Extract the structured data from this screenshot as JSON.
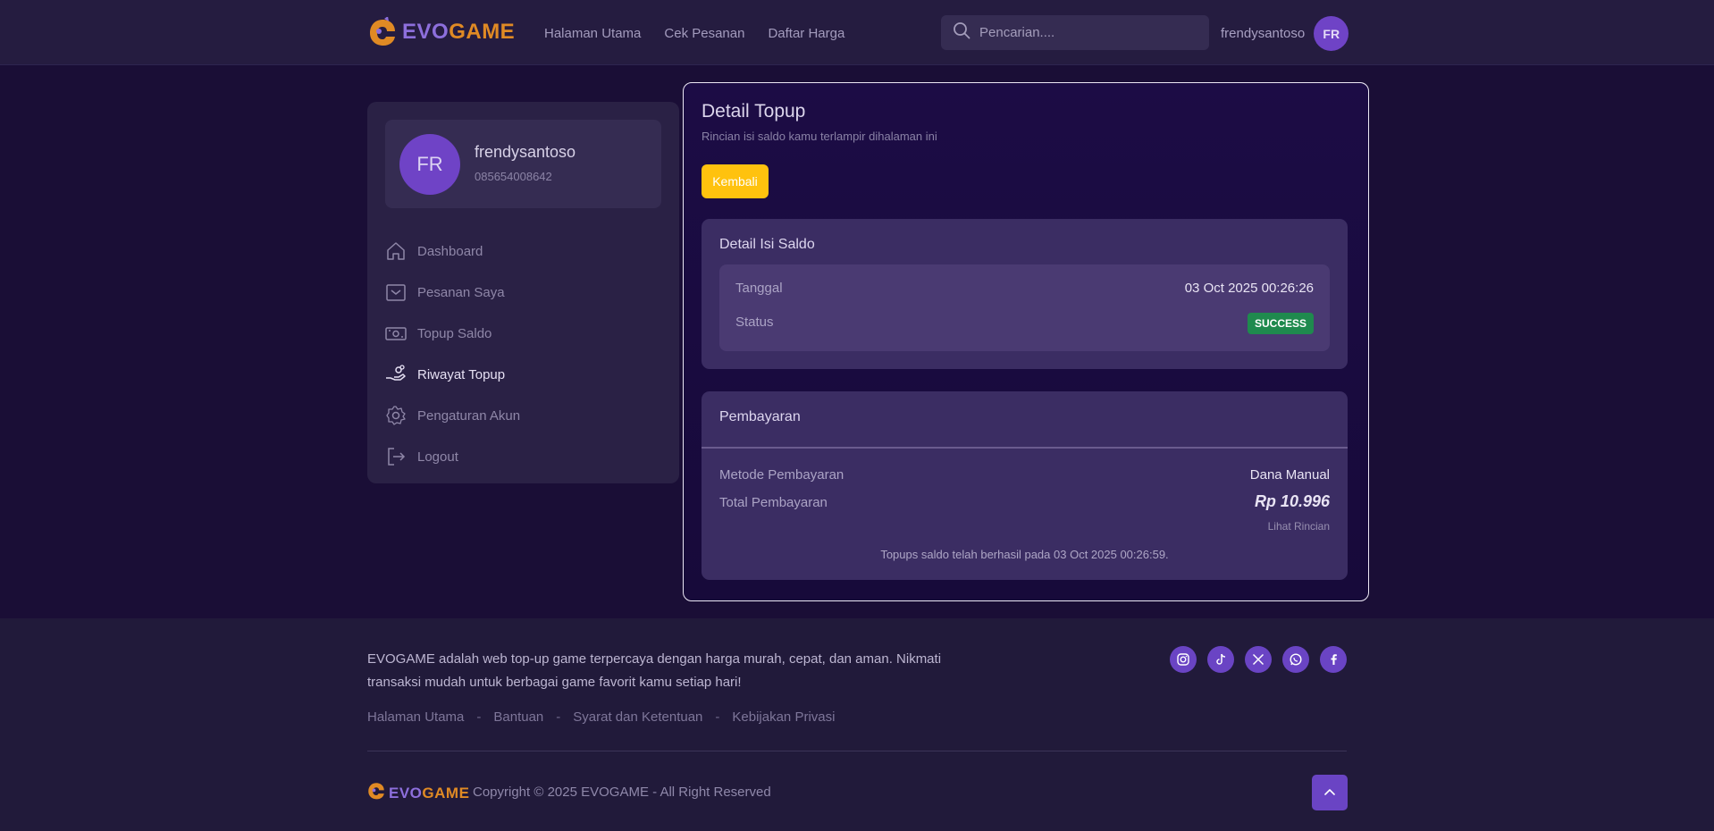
{
  "brand": {
    "evo": "EVO",
    "game": "GAME"
  },
  "nav": {
    "items": [
      "Halaman Utama",
      "Cek Pesanan",
      "Daftar Harga"
    ]
  },
  "search": {
    "placeholder": "Pencarian...."
  },
  "user": {
    "username": "frendysantoso",
    "initials": "FR",
    "phone": "085654008642"
  },
  "sidebar": {
    "items": [
      {
        "label": "Dashboard",
        "icon": "home-icon"
      },
      {
        "label": "Pesanan Saya",
        "icon": "inbox-icon"
      },
      {
        "label": "Topup Saldo",
        "icon": "cash-icon"
      },
      {
        "label": "Riwayat Topup",
        "icon": "hand-coins-icon",
        "active": true
      },
      {
        "label": "Pengaturan Akun",
        "icon": "gear-icon"
      },
      {
        "label": "Logout",
        "icon": "logout-icon"
      }
    ]
  },
  "main": {
    "title": "Detail Topup",
    "subtitle": "Rincian isi saldo kamu terlampir dihalaman ini",
    "back_label": "Kembali",
    "detail": {
      "title": "Detail Isi Saldo",
      "date_label": "Tanggal",
      "date_value": "03 Oct 2025 00:26:26",
      "status_label": "Status",
      "status_value": "SUCCESS",
      "status_color": "#1f8a4e"
    },
    "payment": {
      "title": "Pembayaran",
      "method_label": "Metode Pembayaran",
      "method_value": "Dana Manual",
      "total_label": "Total Pembayaran",
      "total_value": "Rp 10.996",
      "details_link": "Lihat Rincian",
      "note": "Topups saldo telah berhasil pada 03 Oct 2025 00:26:59."
    }
  },
  "footer": {
    "description": "EVOGAME adalah web top-up game terpercaya dengan harga murah, cepat, dan aman. Nikmati transaksi mudah untuk berbagai game favorit kamu setiap hari!",
    "links": [
      "Halaman Utama",
      "Bantuan",
      "Syarat dan Ketentuan",
      "Kebijakan Privasi"
    ],
    "separator": "-",
    "socials": [
      "instagram-icon",
      "tiktok-icon",
      "x-icon",
      "whatsapp-icon",
      "facebook-icon"
    ],
    "copyright": "Copyright © 2025 EVOGAME - All Right Reserved"
  },
  "colors": {
    "accent": "#6a44c4",
    "button": "#ffc20e",
    "brand_orange": "#e08a24",
    "brand_purple": "#8d6fdc"
  }
}
